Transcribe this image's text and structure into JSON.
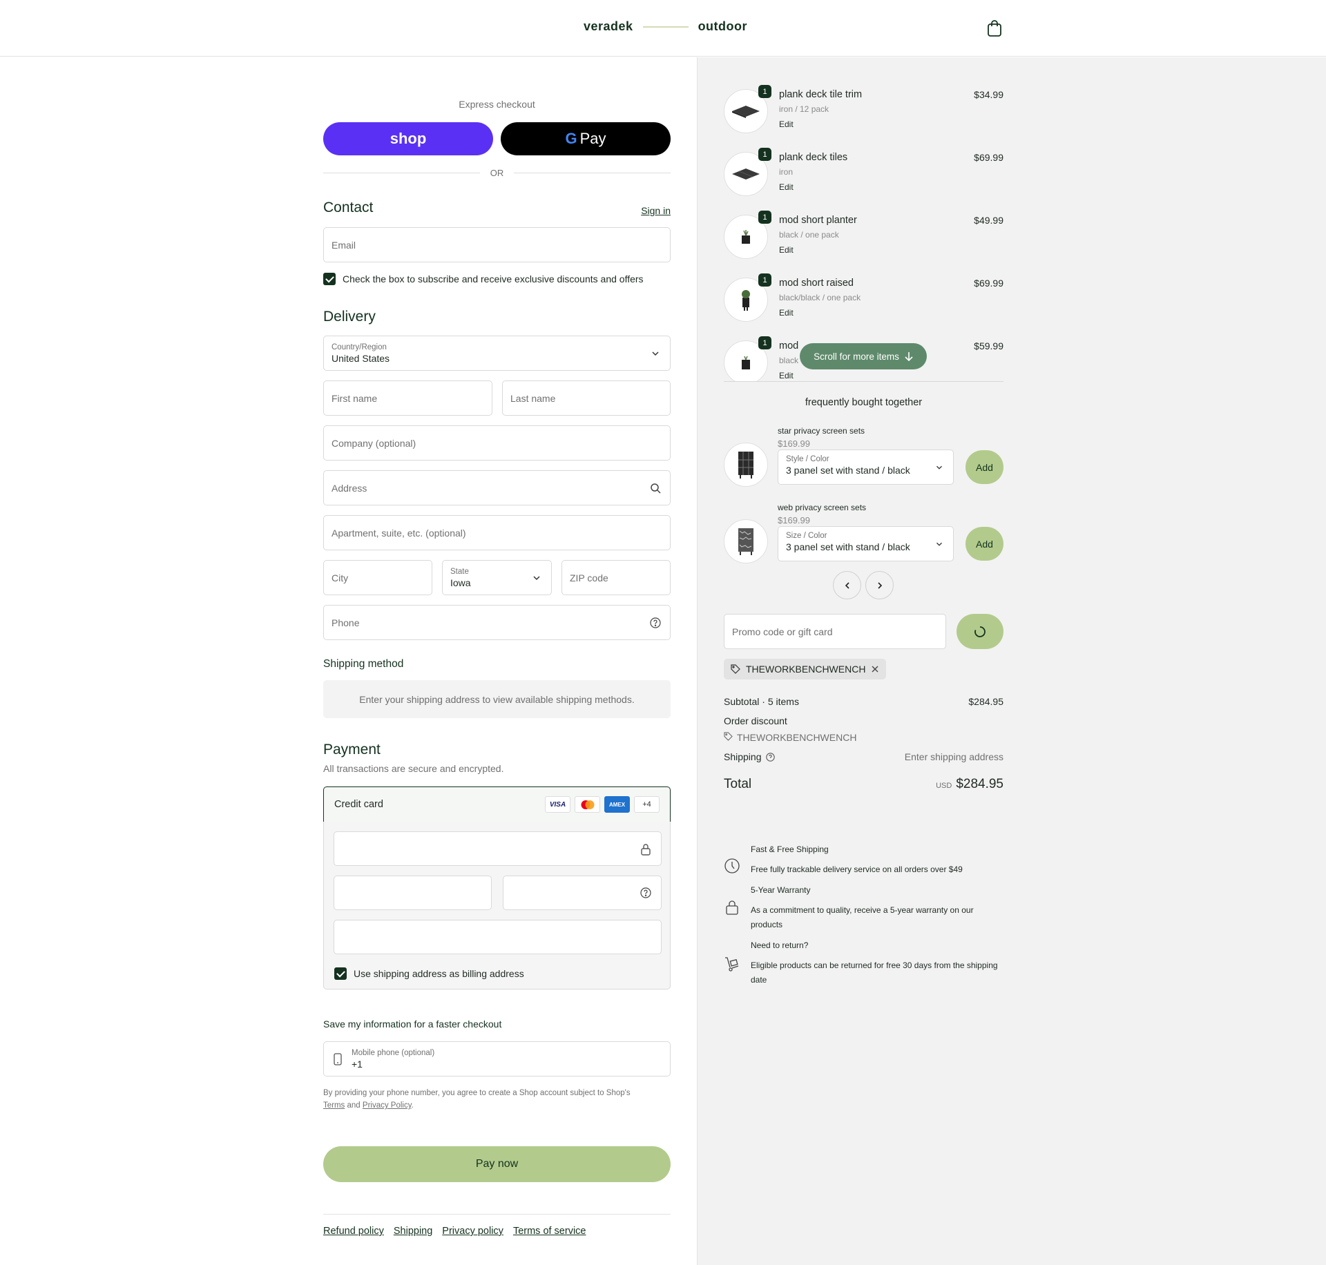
{
  "brand": {
    "left": "veradek",
    "right": "outdoor"
  },
  "colors": {
    "primary": "#14321f",
    "accent": "#b2cb8c",
    "shop": "#5a31f4",
    "scroll_pill": "#5e8a6b"
  },
  "express": {
    "label": "Express checkout",
    "shop_label": "shop",
    "gpay_g": "G",
    "gpay_label": "Pay",
    "or": "OR"
  },
  "contact": {
    "title": "Contact",
    "sign_in": "Sign in",
    "email_placeholder": "Email",
    "subscribe_label": "Check the box to subscribe and receive exclusive discounts and offers"
  },
  "delivery": {
    "title": "Delivery",
    "country_label": "Country/Region",
    "country_value": "United States",
    "first_name": "First name",
    "last_name": "Last name",
    "company": "Company (optional)",
    "address": "Address",
    "apartment": "Apartment, suite, etc. (optional)",
    "city": "City",
    "state_label": "State",
    "state_value": "Iowa",
    "zip": "ZIP code",
    "phone": "Phone"
  },
  "shipping_method": {
    "title": "Shipping method",
    "note": "Enter your shipping address to view available shipping methods."
  },
  "payment": {
    "title": "Payment",
    "subtitle": "All transactions are secure and encrypted.",
    "credit_card": "Credit card",
    "cards": [
      "VISA",
      "MC",
      "AMEX",
      "+4"
    ],
    "billing_same": "Use shipping address as billing address"
  },
  "save_info": {
    "title": "Save my information for a faster checkout",
    "mobile_label": "Mobile phone (optional)",
    "mobile_value": "+1",
    "legal_1": "By providing your phone number, you agree to create a Shop account subject to Shop's",
    "terms": "Terms",
    "and": "and",
    "privacy": "Privacy Policy",
    "period": "."
  },
  "pay_now": "Pay now",
  "footer_links": [
    "Refund policy",
    "Shipping",
    "Privacy policy",
    "Terms of service"
  ],
  "cart": {
    "items": [
      {
        "qty": "1",
        "name": "plank deck tile trim",
        "variant": "iron / 12 pack",
        "edit": "Edit",
        "price": "$34.99"
      },
      {
        "qty": "1",
        "name": "plank deck tiles",
        "variant": "iron",
        "edit": "Edit",
        "price": "$69.99"
      },
      {
        "qty": "1",
        "name": "mod short planter",
        "variant": "black / one pack",
        "edit": "Edit",
        "price": "$49.99"
      },
      {
        "qty": "1",
        "name": "mod short raised",
        "variant": "black/black / one pack",
        "edit": "Edit",
        "price": "$69.99"
      },
      {
        "qty": "1",
        "name": "mod",
        "variant": "black",
        "edit": "Edit",
        "price": "$59.99"
      }
    ],
    "scroll_hint": "Scroll for more items"
  },
  "fbt": {
    "title": "frequently bought together",
    "items": [
      {
        "name": "star privacy screen sets",
        "price": "$169.99",
        "select_label": "Style / Color",
        "select_value": "3 panel set with stand / black",
        "add": "Add"
      },
      {
        "name": "web privacy screen sets",
        "price": "$169.99",
        "select_label": "Size / Color",
        "select_value": "3 panel set with stand / black",
        "add": "Add"
      }
    ]
  },
  "promo": {
    "placeholder": "Promo code or gift card",
    "applied_code": "THEWORKBENCHWENCH"
  },
  "totals": {
    "subtotal_label": "Subtotal · 5 items",
    "subtotal_value": "$284.95",
    "discount_label": "Order discount",
    "discount_code": "THEWORKBENCHWENCH",
    "shipping_label": "Shipping",
    "shipping_value": "Enter shipping address",
    "total_label": "Total",
    "currency": "USD",
    "total_value": "$284.95"
  },
  "perks": [
    {
      "icon": "clock-icon",
      "title": "Fast & Free Shipping",
      "desc": "Free fully trackable delivery service on all orders over $49"
    },
    {
      "icon": "lock-icon",
      "title": "5-Year Warranty",
      "desc": "As a commitment to quality, receive a 5-year warranty on our products"
    },
    {
      "icon": "dolly-icon",
      "title": "Need to return?",
      "desc": "Eligible products can be returned for free 30 days from the shipping date"
    }
  ]
}
